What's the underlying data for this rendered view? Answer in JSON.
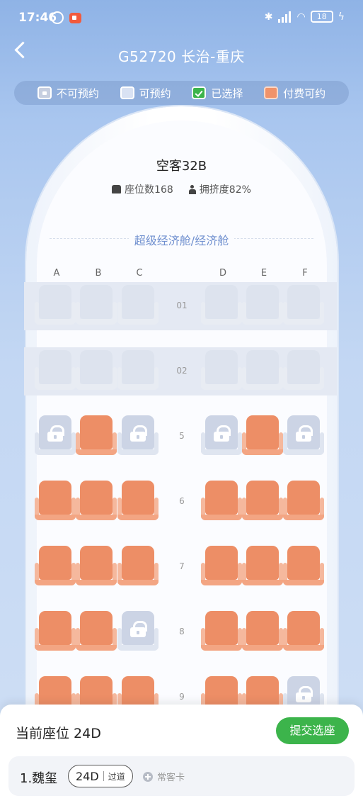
{
  "status_bar": {
    "time": "17:46",
    "battery": "18"
  },
  "header": {
    "title": "G52720  长治-重庆"
  },
  "legend": [
    {
      "label": "不可预约",
      "kind": "unavail"
    },
    {
      "label": "可预约",
      "kind": "avail"
    },
    {
      "label": "已选择",
      "kind": "sel"
    },
    {
      "label": "付费可约",
      "kind": "paid"
    }
  ],
  "plane": {
    "name": "空客32B",
    "seat_count": "座位数168",
    "crowd": "拥挤度82%",
    "cabin": "超级经济舱/经济舱"
  },
  "columns": [
    "A",
    "B",
    "C",
    "D",
    "E",
    "F"
  ],
  "rows": [
    {
      "num": "01",
      "seats": [
        "blocked",
        "blocked",
        "blocked",
        "blocked",
        "blocked",
        "blocked"
      ]
    },
    {
      "num": "02",
      "seats": [
        "blocked",
        "blocked",
        "blocked",
        "blocked",
        "blocked",
        "blocked"
      ]
    },
    {
      "num": "5",
      "seats": [
        "unavail",
        "paid",
        "unavail",
        "unavail",
        "paid",
        "unavail"
      ]
    },
    {
      "num": "6",
      "seats": [
        "paid",
        "paid",
        "paid",
        "paid",
        "paid",
        "paid"
      ]
    },
    {
      "num": "7",
      "seats": [
        "paid",
        "paid",
        "paid",
        "paid",
        "paid",
        "paid"
      ]
    },
    {
      "num": "8",
      "seats": [
        "paid",
        "paid",
        "unavail",
        "paid",
        "paid",
        "paid"
      ]
    },
    {
      "num": "9",
      "seats": [
        "paid",
        "paid",
        "paid",
        "paid",
        "paid",
        "unavail"
      ]
    }
  ],
  "bottom": {
    "current_label": "当前座位 24D",
    "submit_label": "提交选座",
    "passenger": {
      "name": "1.魏玺",
      "seat": "24D",
      "seat_type": "过道",
      "card_label": "常客卡"
    }
  }
}
